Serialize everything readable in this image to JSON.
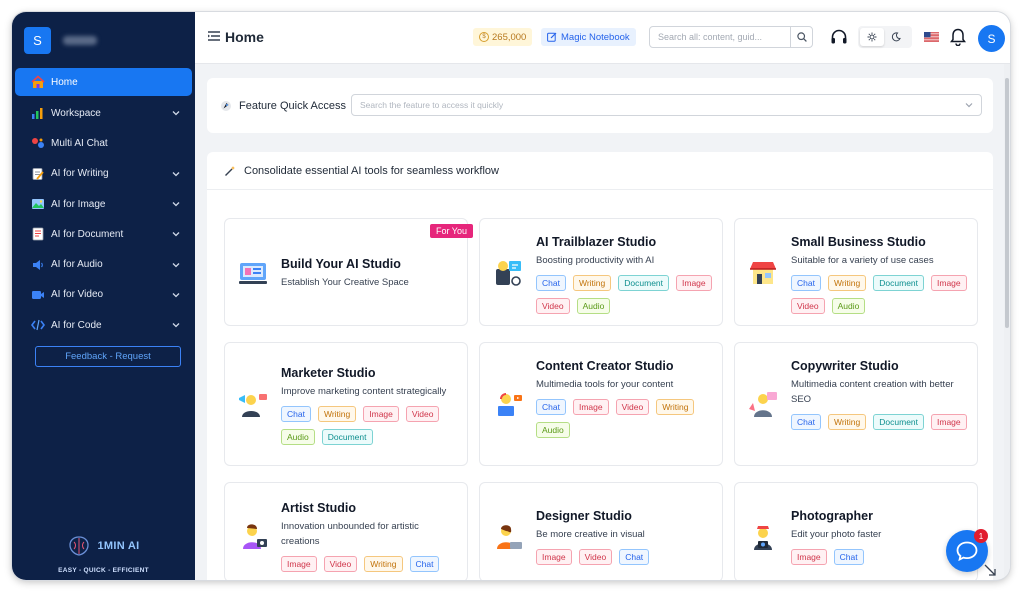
{
  "sidebar": {
    "logo_letter": "S",
    "items": [
      {
        "label": "Home",
        "icon": "home-icon",
        "active": true,
        "has_chevron": false
      },
      {
        "label": "Workspace",
        "icon": "workspace-icon",
        "active": false,
        "has_chevron": true
      },
      {
        "label": "Multi AI Chat",
        "icon": "multi-chat-icon",
        "active": false,
        "has_chevron": false
      },
      {
        "label": "AI for Writing",
        "icon": "writing-icon",
        "active": false,
        "has_chevron": true
      },
      {
        "label": "AI for Image",
        "icon": "image-icon",
        "active": false,
        "has_chevron": true
      },
      {
        "label": "AI for Document",
        "icon": "document-icon",
        "active": false,
        "has_chevron": true
      },
      {
        "label": "AI for Audio",
        "icon": "audio-icon",
        "active": false,
        "has_chevron": true
      },
      {
        "label": "AI for Video",
        "icon": "video-icon",
        "active": false,
        "has_chevron": true
      },
      {
        "label": "AI for Code",
        "icon": "code-icon",
        "active": false,
        "has_chevron": true
      }
    ],
    "feedback_label": "Feedback - Request",
    "brand_name": "1MIN AI",
    "tagline": "EASY - QUICK - EFFICIENT"
  },
  "topbar": {
    "title": "Home",
    "credits": "265,000",
    "notebook_label": "Magic Notebook",
    "search_placeholder": "Search all: content, guid..."
  },
  "quick_access": {
    "label": "Feature Quick Access",
    "placeholder": "Search the feature to access it quickly"
  },
  "tools": {
    "title": "Consolidate essential AI tools for seamless workflow",
    "studios": [
      {
        "title": "Build Your AI Studio",
        "desc": "Establish Your Creative Space",
        "tags": [],
        "ribbon": "For You"
      },
      {
        "title": "AI Trailblazer Studio",
        "desc": "Boosting productivity with AI",
        "tags": [
          "Chat",
          "Writing",
          "Document",
          "Image",
          "Video",
          "Audio"
        ]
      },
      {
        "title": "Small Business Studio",
        "desc": "Suitable for a variety of use cases",
        "tags": [
          "Chat",
          "Writing",
          "Document",
          "Image",
          "Video",
          "Audio"
        ]
      },
      {
        "title": "Marketer Studio",
        "desc": "Improve marketing content strategically",
        "tags": [
          "Chat",
          "Writing",
          "Image",
          "Video",
          "Audio",
          "Document"
        ]
      },
      {
        "title": "Content Creator Studio",
        "desc": "Multimedia tools for your content",
        "tags": [
          "Chat",
          "Image",
          "Video",
          "Writing",
          "Audio"
        ]
      },
      {
        "title": "Copywriter Studio",
        "desc": "Multimedia content creation with better SEO",
        "tags": [
          "Chat",
          "Writing",
          "Document",
          "Image"
        ]
      },
      {
        "title": "Artist Studio",
        "desc": "Innovation unbounded for artistic creations",
        "tags": [
          "Image",
          "Video",
          "Writing",
          "Chat"
        ]
      },
      {
        "title": "Designer Studio",
        "desc": "Be more creative in visual",
        "tags": [
          "Image",
          "Video",
          "Chat"
        ]
      },
      {
        "title": "Photographer",
        "desc": "Edit your photo faster",
        "tags": [
          "Image",
          "Chat"
        ]
      }
    ]
  },
  "chat_widget": {
    "badge": "1"
  },
  "colors": {
    "sidebar_bg": "#0d2147",
    "accent": "#1877f2",
    "ribbon": "#e6267b"
  }
}
